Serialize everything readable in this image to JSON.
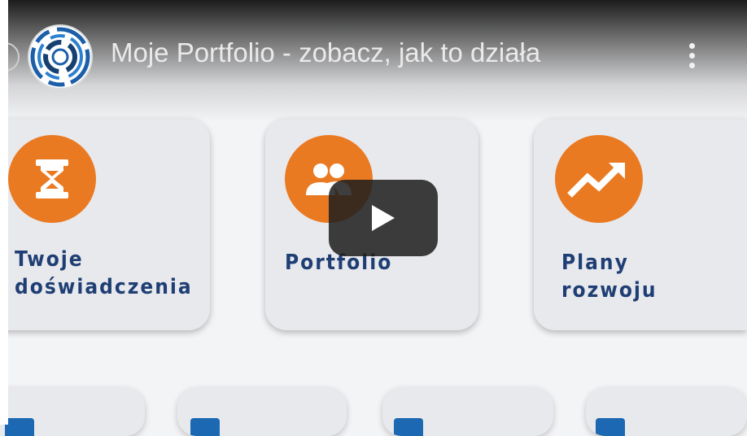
{
  "player": {
    "title": "Moje Portfolio - zobacz, jak to działa",
    "channel_logo_icon": "circular-logo-icon",
    "more_icon": "more-vertical-icon",
    "play_icon": "play-icon",
    "colors": {
      "play_bg": "#212121",
      "accent": "#ea7a22",
      "label": "#1f3f74"
    }
  },
  "cards": [
    {
      "label": "Twoje\ndoświadczenia",
      "icon": "hourglass-icon"
    },
    {
      "label": "Portfolio",
      "icon": "people-icon"
    },
    {
      "label": "Plany\nrozwoju",
      "icon": "trending-up-icon"
    }
  ],
  "bottom_cards": [
    {
      "icon": "folder-icon"
    },
    {
      "icon": "folder-icon"
    },
    {
      "icon": "folder-icon"
    },
    {
      "icon": "folder-icon"
    }
  ]
}
